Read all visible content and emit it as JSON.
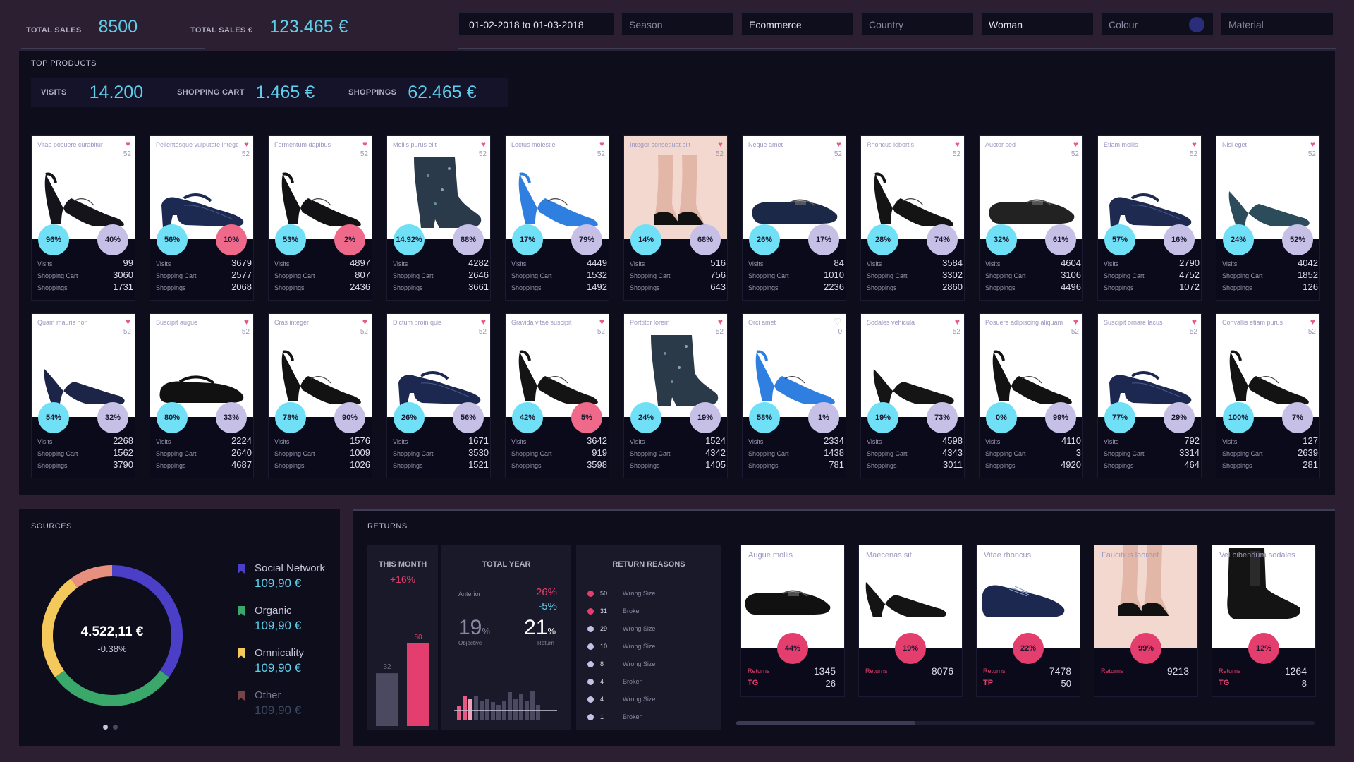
{
  "header": {
    "total_sales_label": "TOTAL SALES",
    "total_sales_value": "8500",
    "total_sales_eur_label": "TOTAL SALES €",
    "total_sales_eur_value": "123.465 €"
  },
  "filters": {
    "date": "01-02-2018 to 01-03-2018",
    "season": "Season",
    "channel": "Ecommerce",
    "country": "Country",
    "gender": "Woman",
    "colour": "Colour",
    "material": "Material"
  },
  "top_products": {
    "title": "TOP PRODUCTS",
    "visits_label": "VISITS",
    "visits_value": "14.200",
    "cart_label": "SHOPPING CART",
    "cart_value": "1.465 €",
    "shoppings_label": "SHOPPINGS",
    "shoppings_value": "62.465 €",
    "row_labels": {
      "visits": "Visits",
      "cart": "Shopping Cart",
      "shoppings": "Shoppings"
    },
    "products": [
      {
        "name": "Vitae posuere curabitur",
        "likes": "52",
        "p1": "96%",
        "p2": "40%",
        "p2_pink": false,
        "visits": "99",
        "cart": "3060",
        "shoppings": "1731",
        "shoe": "sling",
        "color": "#15141a"
      },
      {
        "name": "Pellentesque vulputate integer",
        "likes": "52",
        "p1": "56%",
        "p2": "10%",
        "p2_pink": true,
        "visits": "3679",
        "cart": "2577",
        "shoppings": "2068",
        "shoe": "mary",
        "color": "#1c2a52"
      },
      {
        "name": "Fermentum dapibus",
        "likes": "52",
        "p1": "53%",
        "p2": "2%",
        "p2_pink": true,
        "visits": "4897",
        "cart": "807",
        "shoppings": "2436",
        "shoe": "sling",
        "color": "#121214"
      },
      {
        "name": "Mollis purus elit",
        "likes": "52",
        "p1": "14.92%",
        "p2": "88%",
        "p2_pink": false,
        "visits": "4282",
        "cart": "2646",
        "shoppings": "3661",
        "shoe": "boot",
        "color": "#2b3a4a"
      },
      {
        "name": "Lectus molestie",
        "likes": "52",
        "p1": "17%",
        "p2": "79%",
        "p2_pink": false,
        "visits": "4449",
        "cart": "1532",
        "shoppings": "1492",
        "shoe": "sling",
        "color": "#2e7fe0"
      },
      {
        "name": "Integer consequat elit",
        "likes": "52",
        "p1": "14%",
        "p2": "68%",
        "p2_pink": false,
        "visits": "516",
        "cart": "756",
        "shoppings": "643",
        "shoe": "legs",
        "color": "#111"
      },
      {
        "name": "Neque amet",
        "likes": "52",
        "p1": "26%",
        "p2": "17%",
        "p2_pink": false,
        "visits": "84",
        "cart": "1010",
        "shoppings": "2236",
        "shoe": "loafer",
        "color": "#1c2848"
      },
      {
        "name": "Rhoncus lobortis",
        "likes": "52",
        "p1": "28%",
        "p2": "74%",
        "p2_pink": false,
        "visits": "3584",
        "cart": "3302",
        "shoppings": "2860",
        "shoe": "sling",
        "color": "#141414"
      },
      {
        "name": "Auctor sed",
        "likes": "52",
        "p1": "32%",
        "p2": "61%",
        "p2_pink": false,
        "visits": "4604",
        "cart": "3106",
        "shoppings": "4496",
        "shoe": "loafer",
        "color": "#222"
      },
      {
        "name": "Etiam mollis",
        "likes": "52",
        "p1": "57%",
        "p2": "16%",
        "p2_pink": false,
        "visits": "2790",
        "cart": "4752",
        "shoppings": "1072",
        "shoe": "mary",
        "color": "#1e2a50"
      },
      {
        "name": "Nisl eget",
        "likes": "52",
        "p1": "24%",
        "p2": "52%",
        "p2_pink": false,
        "visits": "4042",
        "cart": "1852",
        "shoppings": "126",
        "shoe": "pump",
        "color": "#2c4c5c"
      },
      {
        "name": "Quam mauris non",
        "likes": "52",
        "p1": "54%",
        "p2": "32%",
        "p2_pink": false,
        "visits": "2268",
        "cart": "1562",
        "shoppings": "3790",
        "shoe": "pump",
        "color": "#1c2448"
      },
      {
        "name": "Suscipit augue",
        "likes": "52",
        "p1": "80%",
        "p2": "33%",
        "p2_pink": false,
        "visits": "2224",
        "cart": "2640",
        "shoppings": "4687",
        "shoe": "flat",
        "color": "#111"
      },
      {
        "name": "Cras integer",
        "likes": "52",
        "p1": "78%",
        "p2": "90%",
        "p2_pink": false,
        "visits": "1576",
        "cart": "1009",
        "shoppings": "1026",
        "shoe": "sling",
        "color": "#121212"
      },
      {
        "name": "Dictum proin quis",
        "likes": "52",
        "p1": "26%",
        "p2": "56%",
        "p2_pink": false,
        "visits": "1671",
        "cart": "3530",
        "shoppings": "1521",
        "shoe": "mary",
        "color": "#1c2850"
      },
      {
        "name": "Gravida vitae suscipit",
        "likes": "52",
        "p1": "42%",
        "p2": "5%",
        "p2_pink": true,
        "visits": "3642",
        "cart": "919",
        "shoppings": "3598",
        "shoe": "sling",
        "color": "#141414"
      },
      {
        "name": "Porttitor lorem",
        "likes": "52",
        "p1": "24%",
        "p2": "19%",
        "p2_pink": false,
        "visits": "1524",
        "cart": "4342",
        "shoppings": "1405",
        "shoe": "boot",
        "color": "#2a3a48"
      },
      {
        "name": "Orci amet",
        "likes": "0",
        "p1": "58%",
        "p2": "1%",
        "p2_pink": false,
        "visits": "2334",
        "cart": "1438",
        "shoppings": "781",
        "shoe": "sling",
        "color": "#2e7fe0",
        "heart_outline": true
      },
      {
        "name": "Sodales vehicula",
        "likes": "52",
        "p1": "19%",
        "p2": "73%",
        "p2_pink": false,
        "visits": "4598",
        "cart": "4343",
        "shoppings": "3011",
        "shoe": "pump",
        "color": "#151515"
      },
      {
        "name": "Posuere adipiscing aliquam",
        "likes": "52",
        "p1": "0%",
        "p2": "99%",
        "p2_pink": false,
        "visits": "4110",
        "cart": "3",
        "shoppings": "4920",
        "shoe": "sling",
        "color": "#121212"
      },
      {
        "name": "Suscipit ornare lacus",
        "likes": "52",
        "p1": "77%",
        "p2": "29%",
        "p2_pink": false,
        "visits": "792",
        "cart": "3314",
        "shoppings": "464",
        "shoe": "mary",
        "color": "#1c2850"
      },
      {
        "name": "Convallis etiam purus",
        "likes": "52",
        "p1": "100%",
        "p2": "7%",
        "p2_pink": false,
        "visits": "127",
        "cart": "2639",
        "shoppings": "281",
        "shoe": "sling",
        "color": "#131313"
      }
    ]
  },
  "sources": {
    "title": "SOURCES",
    "total": "4.522,11 €",
    "change": "-0.38%",
    "items": [
      {
        "name": "Social Network",
        "value": "109,90 €",
        "color": "#4b3fc8"
      },
      {
        "name": "Organic",
        "value": "109,90 €",
        "color": "#3aa86a"
      },
      {
        "name": "Omnicality",
        "value": "109,90 €",
        "color": "#f4c85a"
      },
      {
        "name": "Other",
        "value": "109,90 €",
        "color": "#e07a72"
      }
    ]
  },
  "chart_data": {
    "type": "pie",
    "categories": [
      "Social Network",
      "Organic",
      "Omnicality",
      "Other"
    ],
    "values": [
      35,
      30,
      25,
      10
    ],
    "colors": [
      "#4b3fc8",
      "#3aa86a",
      "#f4c85a",
      "#e8907e"
    ]
  },
  "returns": {
    "title": "RETURNS",
    "this_month_label": "THIS MONTH",
    "this_month_change": "+16%",
    "bar_prev": "32",
    "bar_curr": "50",
    "total_year_label": "TOTAL YEAR",
    "anterior_label": "Anterior",
    "anterior_pct": "26%",
    "anterior_delta": "-5%",
    "objective_value": "19",
    "objective_label": "Objective",
    "return_value": "21",
    "return_label": "Return",
    "pct_symbol": "%",
    "reasons_label": "RETURN REASONS",
    "reasons": [
      {
        "count": "50",
        "reason": "Wrong Size",
        "color": "#e33e6e"
      },
      {
        "count": "31",
        "reason": "Broken",
        "color": "#e33e6e"
      },
      {
        "count": "29",
        "reason": "Wrong Size",
        "color": "#c6c0e6"
      },
      {
        "count": "10",
        "reason": "Wrong Size",
        "color": "#c6c0e6"
      },
      {
        "count": "8",
        "reason": "Wrong Size",
        "color": "#c6c0e6"
      },
      {
        "count": "4",
        "reason": "Broken",
        "color": "#c6c0e6"
      },
      {
        "count": "4",
        "reason": "Wrong Size",
        "color": "#c6c0e6"
      },
      {
        "count": "1",
        "reason": "Broken",
        "color": "#c6c0e6"
      }
    ],
    "products": [
      {
        "name": "Augue mollis",
        "pct": "44%",
        "returns_label": "Returns",
        "returns": "1345",
        "tag": "TG",
        "tag_value": "26",
        "shoe": "loafer",
        "color": "#111"
      },
      {
        "name": "Maecenas sit",
        "pct": "19%",
        "returns_label": "Returns",
        "returns": "8076",
        "tag": "",
        "tag_value": "",
        "shoe": "pump",
        "color": "#141414"
      },
      {
        "name": "Vitae rhoncus",
        "pct": "22%",
        "returns_label": "Returns",
        "returns": "7478",
        "tag": "TP",
        "tag_value": "50",
        "shoe": "oxford",
        "color": "#1c2850"
      },
      {
        "name": "Faucibus laoreet",
        "pct": "99%",
        "returns_label": "Returns",
        "returns": "9213",
        "tag": "",
        "tag_value": "",
        "shoe": "legs",
        "color": "#111"
      },
      {
        "name": "Vel bibendum sodales",
        "pct": "12%",
        "returns_label": "Returns",
        "returns": "1264",
        "tag": "TG",
        "tag_value": "8",
        "shoe": "chelsea",
        "color": "#141414"
      }
    ]
  }
}
